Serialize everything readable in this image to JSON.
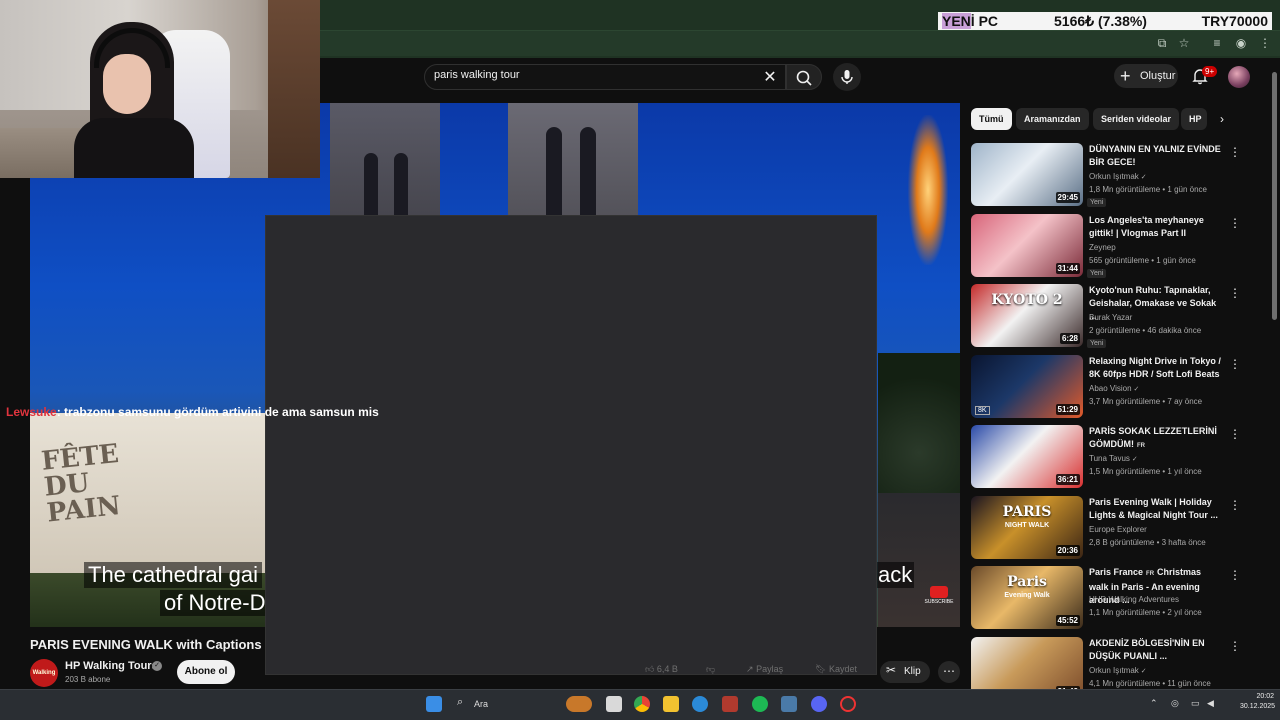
{
  "ticker": {
    "label_a": "YEN",
    "label_b": "İ PC",
    "value": "5166₺ (7.38%)",
    "target": "TRY70000"
  },
  "search": {
    "query": "paris walking tour"
  },
  "header": {
    "create_label": "Oluştur",
    "notifications_badge": "9+"
  },
  "chat": {
    "user": "Lewsuke",
    "message": ": trabzonu samsunu gördüm artivini de ama samsun mis"
  },
  "video": {
    "caption_line1": "The cathedral gai",
    "caption_line2": "of Notre-D",
    "caption_right": "ack",
    "tent_text": "FÊTE DU PAIN",
    "subscribe_overlay": "SUBSCRIBE",
    "title": "PARIS EVENING WALK with Captions | P",
    "channel": "HP Walking Tours",
    "channel_avatar_text": "Walking tours",
    "subscribers": "203 B abone",
    "subscribe_label": "Abone ol",
    "actions": {
      "likes": "6,4 B",
      "share": "Paylaş",
      "save": "Kaydet",
      "clip": "Klip"
    }
  },
  "chips": [
    {
      "label": "Tümü",
      "active": true
    },
    {
      "label": "Aramanızdan",
      "active": false
    },
    {
      "label": "Seriden videolar",
      "active": false
    },
    {
      "label": "HP",
      "active": false
    }
  ],
  "recommendations": [
    {
      "title": "DÜNYANIN EN YALNIZ EVİNDE BİR GECE!",
      "channel": "Orkun Işıtmak",
      "verified": true,
      "meta": "1,8 Mn görüntüleme • 1 gün önce",
      "duration": "29:45",
      "new_label": "Yeni",
      "colors": [
        "#9fb4c9",
        "#e8eef4",
        "#5a6f86"
      ]
    },
    {
      "title": "Los Angeles'ta meyhaneye gittik! | Vlogmas Part II",
      "channel": "Zeynep",
      "verified": false,
      "meta": "565 görüntüleme • 1 gün önce",
      "duration": "31:44",
      "new_label": "Yeni",
      "colors": [
        "#d8657a",
        "#f4c2c8",
        "#7a2a38"
      ]
    },
    {
      "title": "Kyoto'nun Ruhu: Tapınaklar, Geishalar, Omakase ve Sokak ...",
      "channel": "Burak Yazar",
      "verified": false,
      "meta": "2 görüntüleme • 46 dakika önce",
      "duration": "6:28",
      "new_label": "Yeni",
      "thumb_text": "KYOTO 2",
      "colors": [
        "#c42a2a",
        "#f2f2f2",
        "#3a2a2a"
      ]
    },
    {
      "title": "Relaxing Night Drive in Tokyo / 8K 60fps HDR / Soft Lofi Beats",
      "channel": "Abao Vision",
      "verified": true,
      "meta": "3,7 Mn görüntüleme • 7 ay önce",
      "duration": "51:29",
      "badge": "8K",
      "colors": [
        "#0a1530",
        "#1c3868",
        "#e25a2a"
      ]
    },
    {
      "title": "PARİS SOKAK LEZZETLERİNİ GÖMDÜM!",
      "title_suffix": "FR",
      "channel": "Tuna Tavus",
      "verified": true,
      "meta": "1,5 Mn görüntüleme • 1 yıl önce",
      "duration": "36:21",
      "colors": [
        "#2a4aa8",
        "#f2f2f2",
        "#d83030"
      ]
    },
    {
      "title": "Paris Evening Walk | Holiday Lights & Magical Night Tour ...",
      "channel": "Europe Explorer",
      "verified": false,
      "meta": "2,8 B görüntüleme • 3 hafta önce",
      "duration": "20:36",
      "thumb_text": "PARIS",
      "thumb_sub": "NIGHT WALK",
      "colors": [
        "#1a1420",
        "#c8902a",
        "#3a2414"
      ]
    },
    {
      "title": "Paris France",
      "title_suffix": "FR",
      "title_rest": "Christmas walk in Paris - An evening around ...",
      "channel": "UHD Walking Adventures",
      "verified": false,
      "meta": "1,1 Mn görüntüleme • 2 yıl önce",
      "duration": "45:52",
      "thumb_text": "Paris",
      "thumb_sub": "Evening Walk",
      "colors": [
        "#6a4a2a",
        "#e8b868",
        "#3a2a1a"
      ]
    },
    {
      "title": "AKDENİZ BÖLGESİ'NİN EN DÜŞÜK PUANLI ...",
      "channel": "Orkun Işıtmak",
      "verified": true,
      "meta": "4,1 Mn görüntüleme • 11 gün önce",
      "duration": "31:42",
      "colors": [
        "#f2f2f2",
        "#c89a5a",
        "#7a4a2a"
      ]
    }
  ],
  "taskbar": {
    "search_label": "Ara",
    "time": "20:02",
    "date": "30.12.2025"
  }
}
